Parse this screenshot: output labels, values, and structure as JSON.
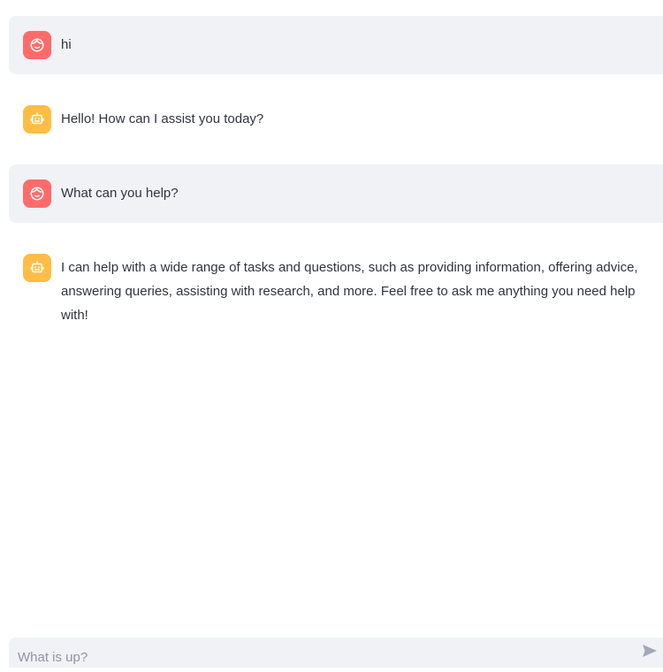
{
  "messages": [
    {
      "role": "user",
      "avatar_icon": "user-face-icon",
      "avatar_color": "#ff6b6b",
      "text": "hi"
    },
    {
      "role": "assistant",
      "avatar_icon": "robot-icon",
      "avatar_color": "#ffbd45",
      "text": "Hello! How can I assist you today?"
    },
    {
      "role": "user",
      "avatar_icon": "user-face-icon",
      "avatar_color": "#ff6b6b",
      "text": "What can you help?"
    },
    {
      "role": "assistant",
      "avatar_icon": "robot-icon",
      "avatar_color": "#ffbd45",
      "text": "I can help with a wide range of tasks and questions, such as providing information, offering advice, answering queries, assisting with research, and more. Feel free to ask me anything you need help with!"
    }
  ],
  "chat_input": {
    "placeholder": "What is up?",
    "value": "",
    "send_icon": "send-icon"
  },
  "colors": {
    "user_bubble": "#f0f2f6",
    "text": "#31333f",
    "placeholder": "#8f93a3"
  }
}
